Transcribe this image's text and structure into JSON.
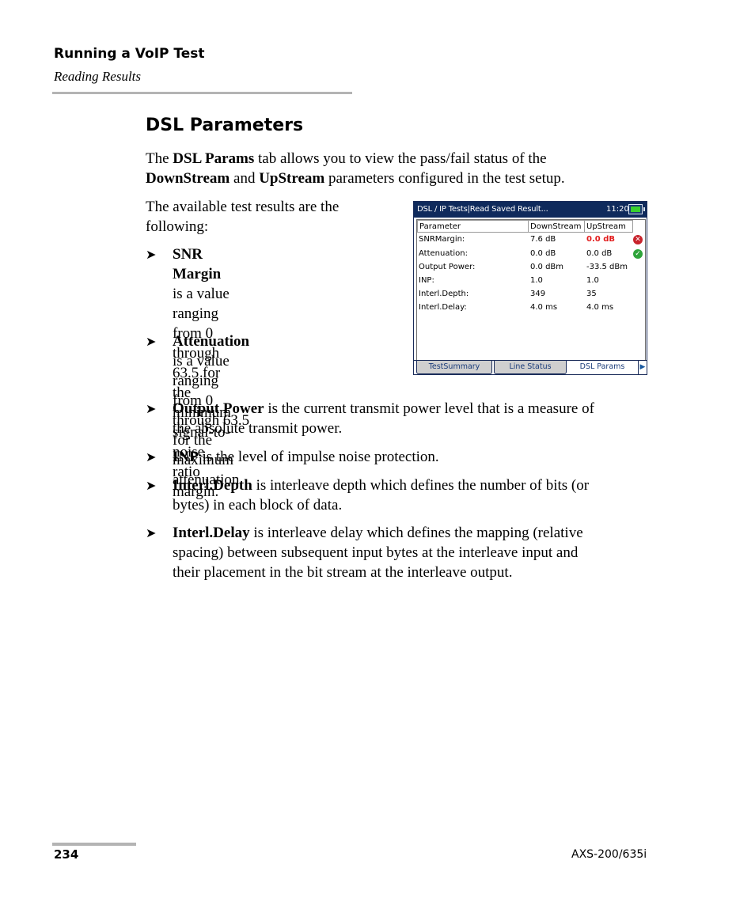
{
  "header": {
    "chapter": "Running a VoIP Test",
    "section": "Reading Results"
  },
  "section_title": "DSL Parameters",
  "intro": {
    "t1": "The ",
    "b1": "DSL Params",
    "t2": " tab allows you to view the pass/fail status of the",
    "b2": "DownStream",
    "t3": " and ",
    "b3": "UpStream",
    "t4": " parameters configured in the test setup."
  },
  "available": {
    "line1": "The available test results are the",
    "line2": "following:"
  },
  "bullets": [
    {
      "term": "SNR Margin",
      "lines": [
        " is a value ranging",
        "from 0 through 63.5 for the",
        "minimum signal-to-noise ratio",
        "margin."
      ]
    },
    {
      "term": "Attenuation",
      "lines": [
        " is a value ranging",
        "from 0 through 63.5 for the",
        "maximum attenuation."
      ]
    },
    {
      "term": "Output Power",
      "lines": [
        " is the current transmit power level that is a measure of",
        "the absolute transmit power."
      ]
    },
    {
      "term": "INP",
      "lines": [
        " is the level of impulse noise protection."
      ]
    },
    {
      "term": "Interl.Depth",
      "lines": [
        " is interleave depth which defines the number of bits (or",
        "bytes) in each block of data."
      ]
    },
    {
      "term": "Interl.Delay",
      "lines": [
        " is interleave delay which defines the mapping (relative",
        "spacing) between subsequent input bytes at the interleave input and",
        "their placement in the bit stream at the interleave output."
      ]
    }
  ],
  "bullet_glyph": "➤",
  "device": {
    "title": "DSL / IP Tests|Read Saved Result...",
    "clock": "11:20",
    "battery_icon": "battery-charging-icon",
    "columns": [
      "Parameter",
      "DownStream",
      "UpStream"
    ],
    "rows": [
      {
        "param": "SNRMargin:",
        "down": "7.6  dB",
        "up": "0.0  dB",
        "status": "fail"
      },
      {
        "param": "Attenuation:",
        "down": "0.0  dB",
        "up": "0.0  dB",
        "status": "pass"
      },
      {
        "param": "Output Power:",
        "down": "0.0  dBm",
        "up": "-33.5  dBm",
        "status": ""
      },
      {
        "param": "INP:",
        "down": "1.0",
        "up": "1.0",
        "status": ""
      },
      {
        "param": "Interl.Depth:",
        "down": "349",
        "up": "35",
        "status": ""
      },
      {
        "param": "Interl.Delay:",
        "down": "4.0 ms",
        "up": "4.0 ms",
        "status": ""
      }
    ],
    "status_glyphs": {
      "fail": "✕",
      "pass": "✓"
    },
    "tabs": [
      {
        "label": "TestSummary",
        "active": false
      },
      {
        "label": "Line Status",
        "active": false
      },
      {
        "label": "DSL Params",
        "active": true
      }
    ],
    "tab_scroll_glyph": "▶",
    "colors": {
      "titlebar": "#0f2a5c",
      "fail_text": "#e21b1b",
      "fail_icon": "#c8232c",
      "pass_icon": "#2ea43a"
    }
  },
  "footer": {
    "page_number": "234",
    "model": "AXS-200/635i"
  }
}
